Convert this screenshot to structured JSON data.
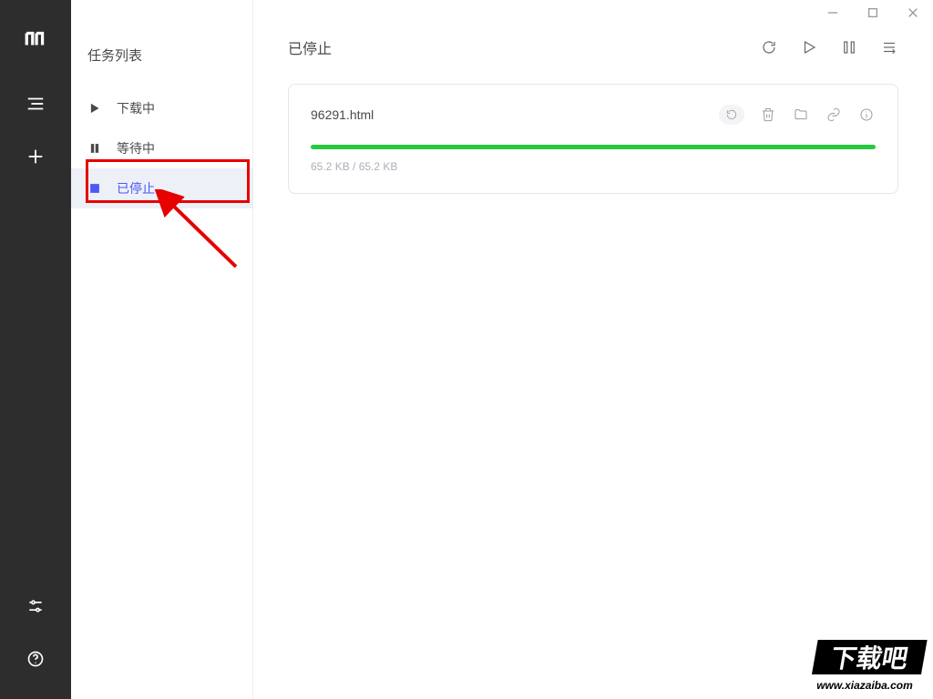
{
  "sidebar": {
    "title": "任务列表",
    "items": [
      {
        "label": "下载中"
      },
      {
        "label": "等待中"
      },
      {
        "label": "已停止"
      }
    ]
  },
  "main": {
    "title": "已停止"
  },
  "task": {
    "filename": "96291.html",
    "size_text": "65.2 KB / 65.2 KB",
    "progress_pct": 100
  },
  "colors": {
    "accent": "#4b59f7",
    "progress": "#27c93f",
    "highlight": "#e60000"
  },
  "watermark": {
    "text_cn": "下载吧",
    "text_url": "www.xiazaiba.com"
  }
}
